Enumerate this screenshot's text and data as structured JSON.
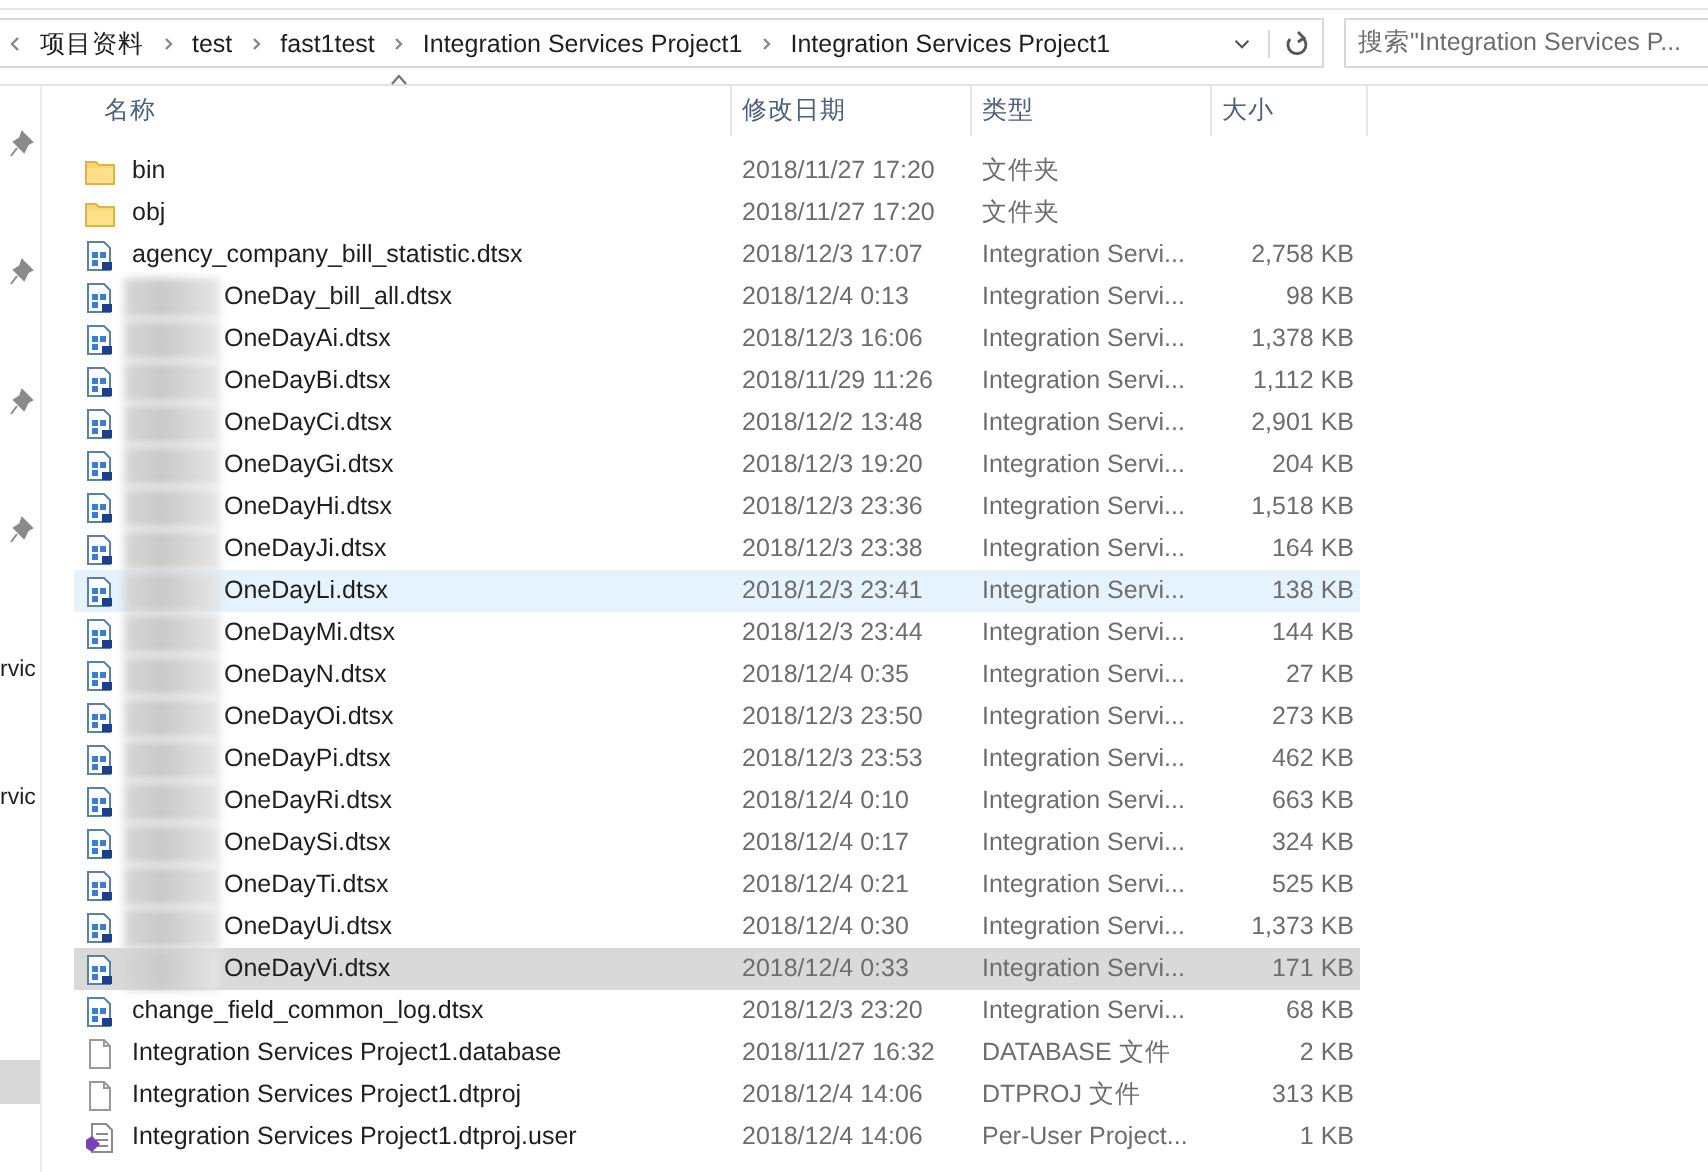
{
  "address_bar": {
    "crumbs": [
      "项目资料",
      "test",
      "fast1test",
      "Integration Services Project1",
      "Integration Services Project1"
    ]
  },
  "search": {
    "placeholder": "搜索\"Integration Services P..."
  },
  "nav_pane": {
    "items": [
      {
        "label": "rvic",
        "selected": false
      },
      {
        "label": "rvic",
        "selected": false
      },
      {
        "selected": true
      }
    ]
  },
  "columns": [
    {
      "label": "名称",
      "sorted": true
    },
    {
      "label": "修改日期",
      "sorted": false
    },
    {
      "label": "类型",
      "sorted": false
    },
    {
      "label": "大小",
      "sorted": false
    }
  ],
  "rows": [
    {
      "kind": "folder",
      "name": "bin",
      "date": "2018/11/27 17:20",
      "type": "文件夹",
      "redacted": false,
      "selected": false,
      "hovered": false
    },
    {
      "kind": "folder",
      "name": "obj",
      "date": "2018/11/27 17:20",
      "type": "文件夹",
      "redacted": false,
      "selected": false,
      "hovered": false
    },
    {
      "kind": "package",
      "name": "agency_company_bill_statistic.dtsx",
      "date": "2018/12/3 17:07",
      "type": "Integration Servi...",
      "size": "2,758 KB",
      "redacted": false,
      "selected": false,
      "hovered": false
    },
    {
      "kind": "package",
      "name": "OneDay_bill_all.dtsx",
      "date": "2018/12/4 0:13",
      "type": "Integration Servi...",
      "size": "98 KB",
      "redacted": true,
      "selected": false,
      "hovered": false
    },
    {
      "kind": "package",
      "name": "OneDayAi.dtsx",
      "date": "2018/12/3 16:06",
      "type": "Integration Servi...",
      "size": "1,378 KB",
      "redacted": true,
      "selected": false,
      "hovered": false
    },
    {
      "kind": "package",
      "name": "OneDayBi.dtsx",
      "date": "2018/11/29 11:26",
      "type": "Integration Servi...",
      "size": "1,112 KB",
      "redacted": true,
      "selected": false,
      "hovered": false
    },
    {
      "kind": "package",
      "name": "OneDayCi.dtsx",
      "date": "2018/12/2 13:48",
      "type": "Integration Servi...",
      "size": "2,901 KB",
      "redacted": true,
      "selected": false,
      "hovered": false
    },
    {
      "kind": "package",
      "name": "OneDayGi.dtsx",
      "date": "2018/12/3 19:20",
      "type": "Integration Servi...",
      "size": "204 KB",
      "redacted": true,
      "selected": false,
      "hovered": false
    },
    {
      "kind": "package",
      "name": "OneDayHi.dtsx",
      "date": "2018/12/3 23:36",
      "type": "Integration Servi...",
      "size": "1,518 KB",
      "redacted": true,
      "selected": false,
      "hovered": false
    },
    {
      "kind": "package",
      "name": "OneDayJi.dtsx",
      "date": "2018/12/3 23:38",
      "type": "Integration Servi...",
      "size": "164 KB",
      "redacted": true,
      "selected": false,
      "hovered": false
    },
    {
      "kind": "package",
      "name": "OneDayLi.dtsx",
      "date": "2018/12/3 23:41",
      "type": "Integration Servi...",
      "size": "138 KB",
      "redacted": true,
      "selected": false,
      "hovered": true
    },
    {
      "kind": "package",
      "name": "OneDayMi.dtsx",
      "date": "2018/12/3 23:44",
      "type": "Integration Servi...",
      "size": "144 KB",
      "redacted": true,
      "selected": false,
      "hovered": false
    },
    {
      "kind": "package",
      "name": "OneDayN.dtsx",
      "date": "2018/12/4 0:35",
      "type": "Integration Servi...",
      "size": "27 KB",
      "redacted": true,
      "selected": false,
      "hovered": false
    },
    {
      "kind": "package",
      "name": "OneDayOi.dtsx",
      "date": "2018/12/3 23:50",
      "type": "Integration Servi...",
      "size": "273 KB",
      "redacted": true,
      "selected": false,
      "hovered": false
    },
    {
      "kind": "package",
      "name": "OneDayPi.dtsx",
      "date": "2018/12/3 23:53",
      "type": "Integration Servi...",
      "size": "462 KB",
      "redacted": true,
      "selected": false,
      "hovered": false
    },
    {
      "kind": "package",
      "name": "OneDayRi.dtsx",
      "date": "2018/12/4 0:10",
      "type": "Integration Servi...",
      "size": "663 KB",
      "redacted": true,
      "selected": false,
      "hovered": false
    },
    {
      "kind": "package",
      "name": "OneDaySi.dtsx",
      "date": "2018/12/4 0:17",
      "type": "Integration Servi...",
      "size": "324 KB",
      "redacted": true,
      "selected": false,
      "hovered": false
    },
    {
      "kind": "package",
      "name": "OneDayTi.dtsx",
      "date": "2018/12/4 0:21",
      "type": "Integration Servi...",
      "size": "525 KB",
      "redacted": true,
      "selected": false,
      "hovered": false
    },
    {
      "kind": "package",
      "name": "OneDayUi.dtsx",
      "date": "2018/12/4 0:30",
      "type": "Integration Servi...",
      "size": "1,373 KB",
      "redacted": true,
      "selected": false,
      "hovered": false
    },
    {
      "kind": "package",
      "name": "OneDayVi.dtsx",
      "date": "2018/12/4 0:33",
      "type": "Integration Servi...",
      "size": "171 KB",
      "redacted": true,
      "selected": true,
      "hovered": false
    },
    {
      "kind": "package",
      "name": "change_field_common_log.dtsx",
      "date": "2018/12/3 23:20",
      "type": "Integration Servi...",
      "size": "68 KB",
      "redacted": false,
      "selected": false,
      "hovered": false
    },
    {
      "kind": "file",
      "name": "Integration Services Project1.database",
      "date": "2018/11/27 16:32",
      "type": "DATABASE 文件",
      "size": "2 KB",
      "redacted": false,
      "selected": false,
      "hovered": false
    },
    {
      "kind": "file",
      "name": "Integration Services Project1.dtproj",
      "date": "2018/12/4 14:06",
      "type": "DTPROJ 文件",
      "size": "313 KB",
      "redacted": false,
      "selected": false,
      "hovered": false
    },
    {
      "kind": "usersettings",
      "name": "Integration Services Project1.dtproj.user",
      "date": "2018/12/4 14:06",
      "type": "Per-User Project...",
      "size": "1 KB",
      "redacted": false,
      "selected": false,
      "hovered": false
    }
  ]
}
